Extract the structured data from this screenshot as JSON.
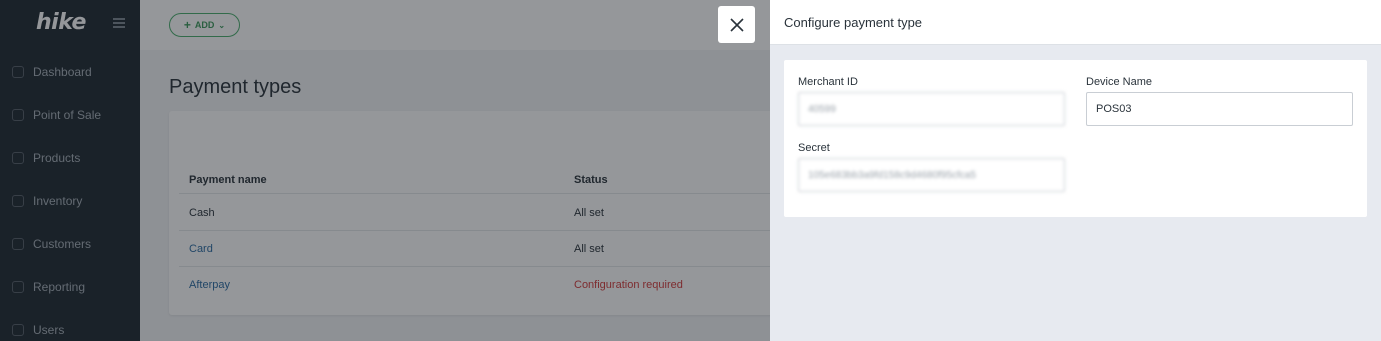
{
  "sidebar": {
    "logo": "hike",
    "items": [
      {
        "label": "Dashboard"
      },
      {
        "label": "Point of Sale"
      },
      {
        "label": "Products"
      },
      {
        "label": "Inventory"
      },
      {
        "label": "Customers"
      },
      {
        "label": "Reporting"
      },
      {
        "label": "Users"
      }
    ]
  },
  "topbar": {
    "add_label": "ADD"
  },
  "page": {
    "title": "Payment types"
  },
  "table": {
    "headers": [
      "Payment name",
      "Status"
    ],
    "rows": [
      {
        "name": "Cash",
        "status": "All set"
      },
      {
        "name": "Card",
        "status": "All set"
      },
      {
        "name": "Afterpay",
        "status": "Configuration required"
      }
    ]
  },
  "panel": {
    "title": "Configure payment type",
    "merchant_id_label": "Merchant ID",
    "merchant_id_value": "40599",
    "device_name_label": "Device Name",
    "device_name_value": "POS03",
    "secret_label": "Secret",
    "secret_value": "105e683bb3a9fd158c9d4680f95cfca5"
  },
  "colors": {
    "sidebar_bg": "#1f2a32",
    "accent_green": "#4caf6e",
    "link_blue": "#2d6ca2",
    "warning_red": "#d43c3c"
  }
}
